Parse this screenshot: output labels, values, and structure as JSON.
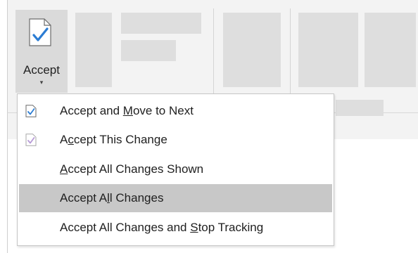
{
  "ribbon": {
    "accept_button": {
      "label": "Accept",
      "caret": "▾",
      "icon": "document-check-icon"
    }
  },
  "menu": {
    "items": [
      {
        "pre": "Accept and ",
        "key": "M",
        "post": "ove to Next",
        "icon": "document-check-icon",
        "highlighted": false
      },
      {
        "pre": "A",
        "key": "c",
        "post": "cept This Change",
        "icon": "document-check-faded-icon",
        "highlighted": false
      },
      {
        "pre": "",
        "key": "A",
        "post": "ccept All Changes Shown",
        "icon": "",
        "highlighted": false
      },
      {
        "pre": "Accept A",
        "key": "l",
        "post": "l Changes",
        "icon": "",
        "highlighted": true
      },
      {
        "pre": "Accept All Changes and ",
        "key": "S",
        "post": "top Tracking",
        "icon": "",
        "highlighted": false
      }
    ]
  },
  "colors": {
    "accent_check": "#2b7cd3",
    "highlight": "#c8c8c8",
    "ribbon_bg": "#f3f3f3"
  }
}
